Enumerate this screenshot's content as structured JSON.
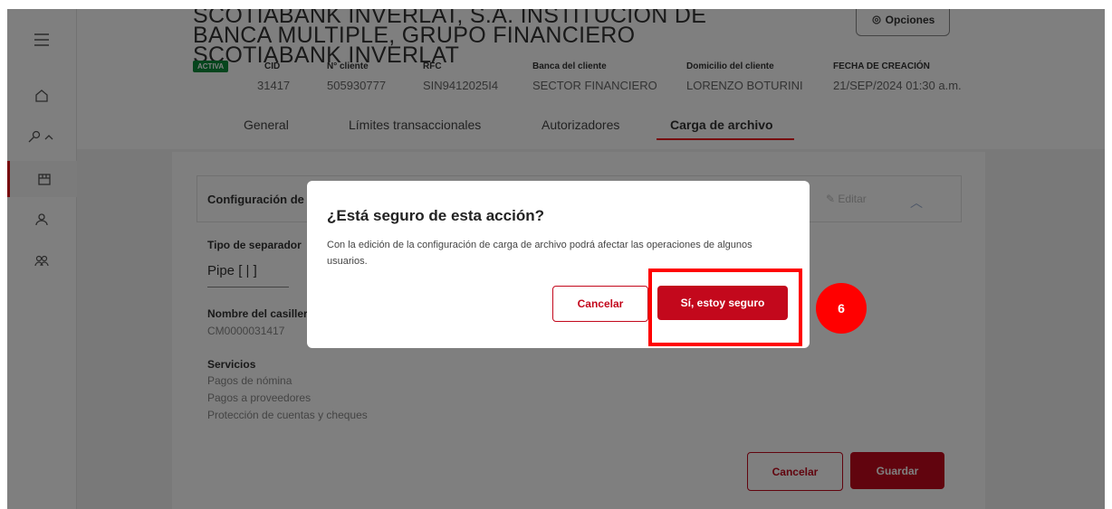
{
  "header": {
    "title": "SCOTIABANK INVERLAT, S.A. INSTITUCION DE BANCA MULTIPLE, GRUPO FINANCIERO SCOTIABANK INVERLAT",
    "options_label": "Opciones",
    "status_badge": "ACTIVA",
    "meta": [
      {
        "label": "CID",
        "value": "31417"
      },
      {
        "label": "N° cliente",
        "value": "505930777"
      },
      {
        "label": "RFC",
        "value": "SIN9412025I4"
      },
      {
        "label": "Banca del cliente",
        "value": "SECTOR FINANCIERO"
      },
      {
        "label": "Domicilio del cliente",
        "value": "LORENZO BOTURINI"
      },
      {
        "label": "FECHA DE CREACIÓN",
        "value": "21/SEP/2024 01:30 a.m."
      }
    ]
  },
  "tabs": [
    {
      "label": "General"
    },
    {
      "label": "Límites transaccionales"
    },
    {
      "label": "Autorizadores"
    },
    {
      "label": "Carga de archivo",
      "active": true
    }
  ],
  "config": {
    "title": "Configuración de",
    "edit_label": "Editar",
    "separator_label": "Tipo de separador",
    "separator_value": "Pipe [ | ]",
    "mailbox_label": "Nombre del casiller",
    "mailbox_value": "CM0000031417",
    "services_label": "Servicios",
    "services": [
      "Pagos de nómina",
      "Pagos a proveedores",
      "Protección de cuentas y cheques"
    ],
    "cancel_label": "Cancelar",
    "save_label": "Guardar"
  },
  "modal": {
    "title": "¿Está seguro de esta acción?",
    "body": "Con la edición de la configuración de carga de archivo podrá afectar las operaciones de algunos usuarios.",
    "cancel_label": "Cancelar",
    "confirm_label": "Sí, estoy seguro"
  },
  "annotation": {
    "step_number": "6"
  },
  "colors": {
    "accent": "#c3081c",
    "highlight": "#ff0000",
    "badge": "#0a8a3a"
  }
}
